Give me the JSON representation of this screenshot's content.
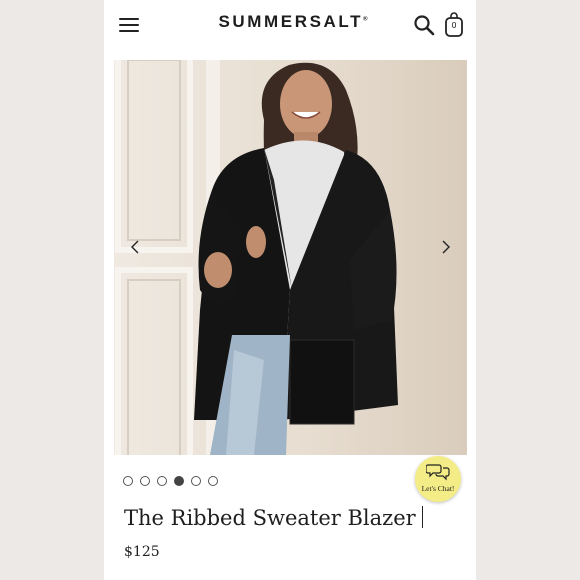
{
  "header": {
    "brand": "SUMMERSALT",
    "brand_mark": "®",
    "menu_icon": "hamburger-menu-icon",
    "search_icon": "search-icon",
    "bag_icon": "shopping-bag-icon",
    "bag_count": "0"
  },
  "carousel": {
    "image": "Woman in a black ribbed sweater blazer over a white turtleneck and light jeans",
    "prev_icon": "chevron-left-icon",
    "next_icon": "chevron-right-icon",
    "slide_count": 6,
    "active_index": 3
  },
  "chat": {
    "label": "Let's Chat!",
    "icon": "chat-bubbles-icon",
    "color": "#f4ec86"
  },
  "product": {
    "title": "The Ribbed Sweater Blazer",
    "price": "$125"
  }
}
